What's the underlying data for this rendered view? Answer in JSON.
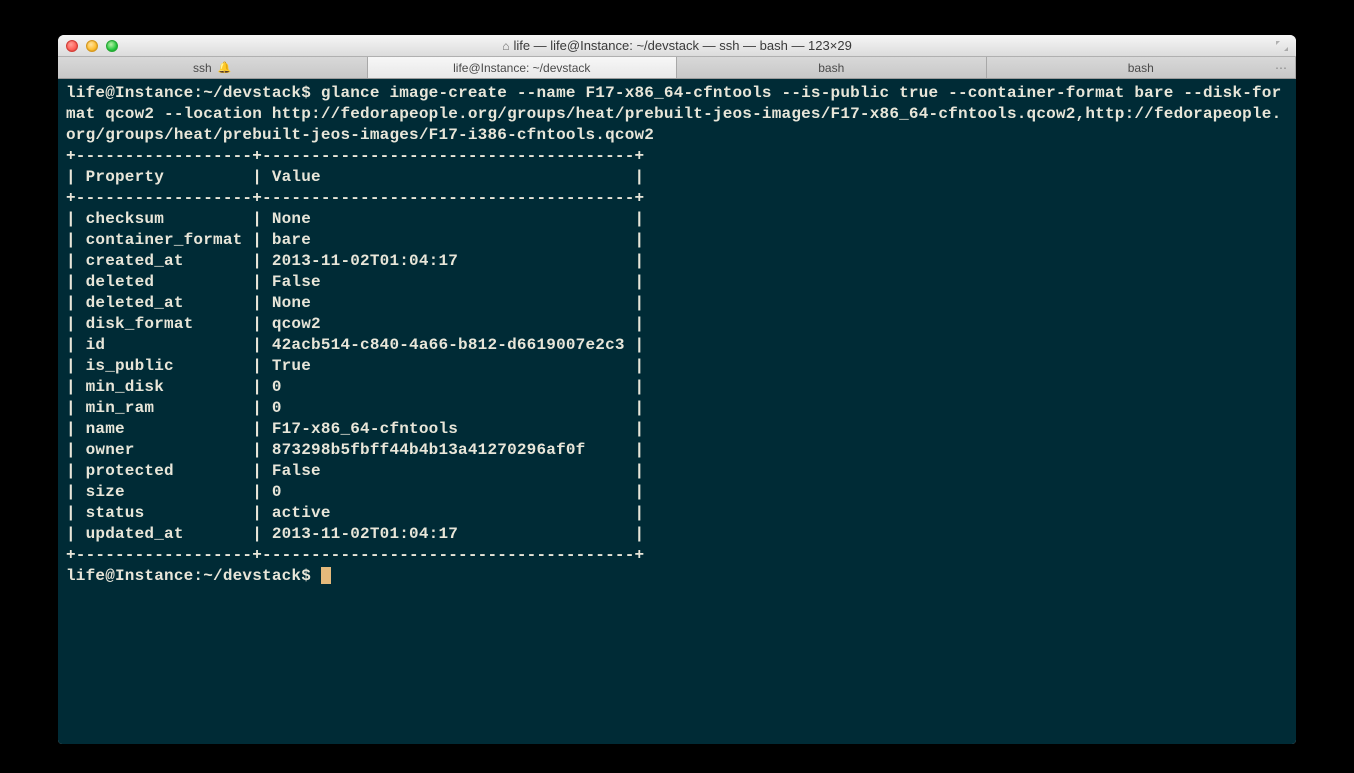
{
  "window": {
    "title": "life — life@Instance: ~/devstack — ssh — bash — 123×29"
  },
  "tabs": [
    {
      "label": "ssh",
      "bell": true
    },
    {
      "label": "life@Instance: ~/devstack",
      "active": true
    },
    {
      "label": "bash"
    },
    {
      "label": "bash",
      "ellipsis": true
    }
  ],
  "terminal": {
    "prompt1": "life@Instance:~/devstack$ ",
    "command": "glance image-create --name F17-x86_64-cfntools --is-public true --container-format bare --disk-format qcow2 --location http://fedorapeople.org/groups/heat/prebuilt-jeos-images/F17-x86_64-cfntools.qcow2,http://fedorapeople.org/groups/heat/prebuilt-jeos-images/F17-i386-cfntools.qcow2",
    "table_header_prop": "Property",
    "table_header_val": "Value",
    "table_rows": [
      {
        "prop": "checksum",
        "val": "None"
      },
      {
        "prop": "container_format",
        "val": "bare"
      },
      {
        "prop": "created_at",
        "val": "2013-11-02T01:04:17"
      },
      {
        "prop": "deleted",
        "val": "False"
      },
      {
        "prop": "deleted_at",
        "val": "None"
      },
      {
        "prop": "disk_format",
        "val": "qcow2"
      },
      {
        "prop": "id",
        "val": "42acb514-c840-4a66-b812-d6619007e2c3"
      },
      {
        "prop": "is_public",
        "val": "True"
      },
      {
        "prop": "min_disk",
        "val": "0"
      },
      {
        "prop": "min_ram",
        "val": "0"
      },
      {
        "prop": "name",
        "val": "F17-x86_64-cfntools"
      },
      {
        "prop": "owner",
        "val": "873298b5fbff44b4b13a41270296af0f"
      },
      {
        "prop": "protected",
        "val": "False"
      },
      {
        "prop": "size",
        "val": "0"
      },
      {
        "prop": "status",
        "val": "active"
      },
      {
        "prop": "updated_at",
        "val": "2013-11-02T01:04:17"
      }
    ],
    "prompt2": "life@Instance:~/devstack$ "
  },
  "chart_data": {
    "type": "table",
    "title": "",
    "columns": [
      "Property",
      "Value"
    ],
    "rows": [
      [
        "checksum",
        "None"
      ],
      [
        "container_format",
        "bare"
      ],
      [
        "created_at",
        "2013-11-02T01:04:17"
      ],
      [
        "deleted",
        "False"
      ],
      [
        "deleted_at",
        "None"
      ],
      [
        "disk_format",
        "qcow2"
      ],
      [
        "id",
        "42acb514-c840-4a66-b812-d6619007e2c3"
      ],
      [
        "is_public",
        "True"
      ],
      [
        "min_disk",
        "0"
      ],
      [
        "min_ram",
        "0"
      ],
      [
        "name",
        "F17-x86_64-cfntools"
      ],
      [
        "owner",
        "873298b5fbff44b4b13a41270296af0f"
      ],
      [
        "protected",
        "False"
      ],
      [
        "size",
        "0"
      ],
      [
        "status",
        "active"
      ],
      [
        "updated_at",
        "2013-11-02T01:04:17"
      ]
    ]
  }
}
